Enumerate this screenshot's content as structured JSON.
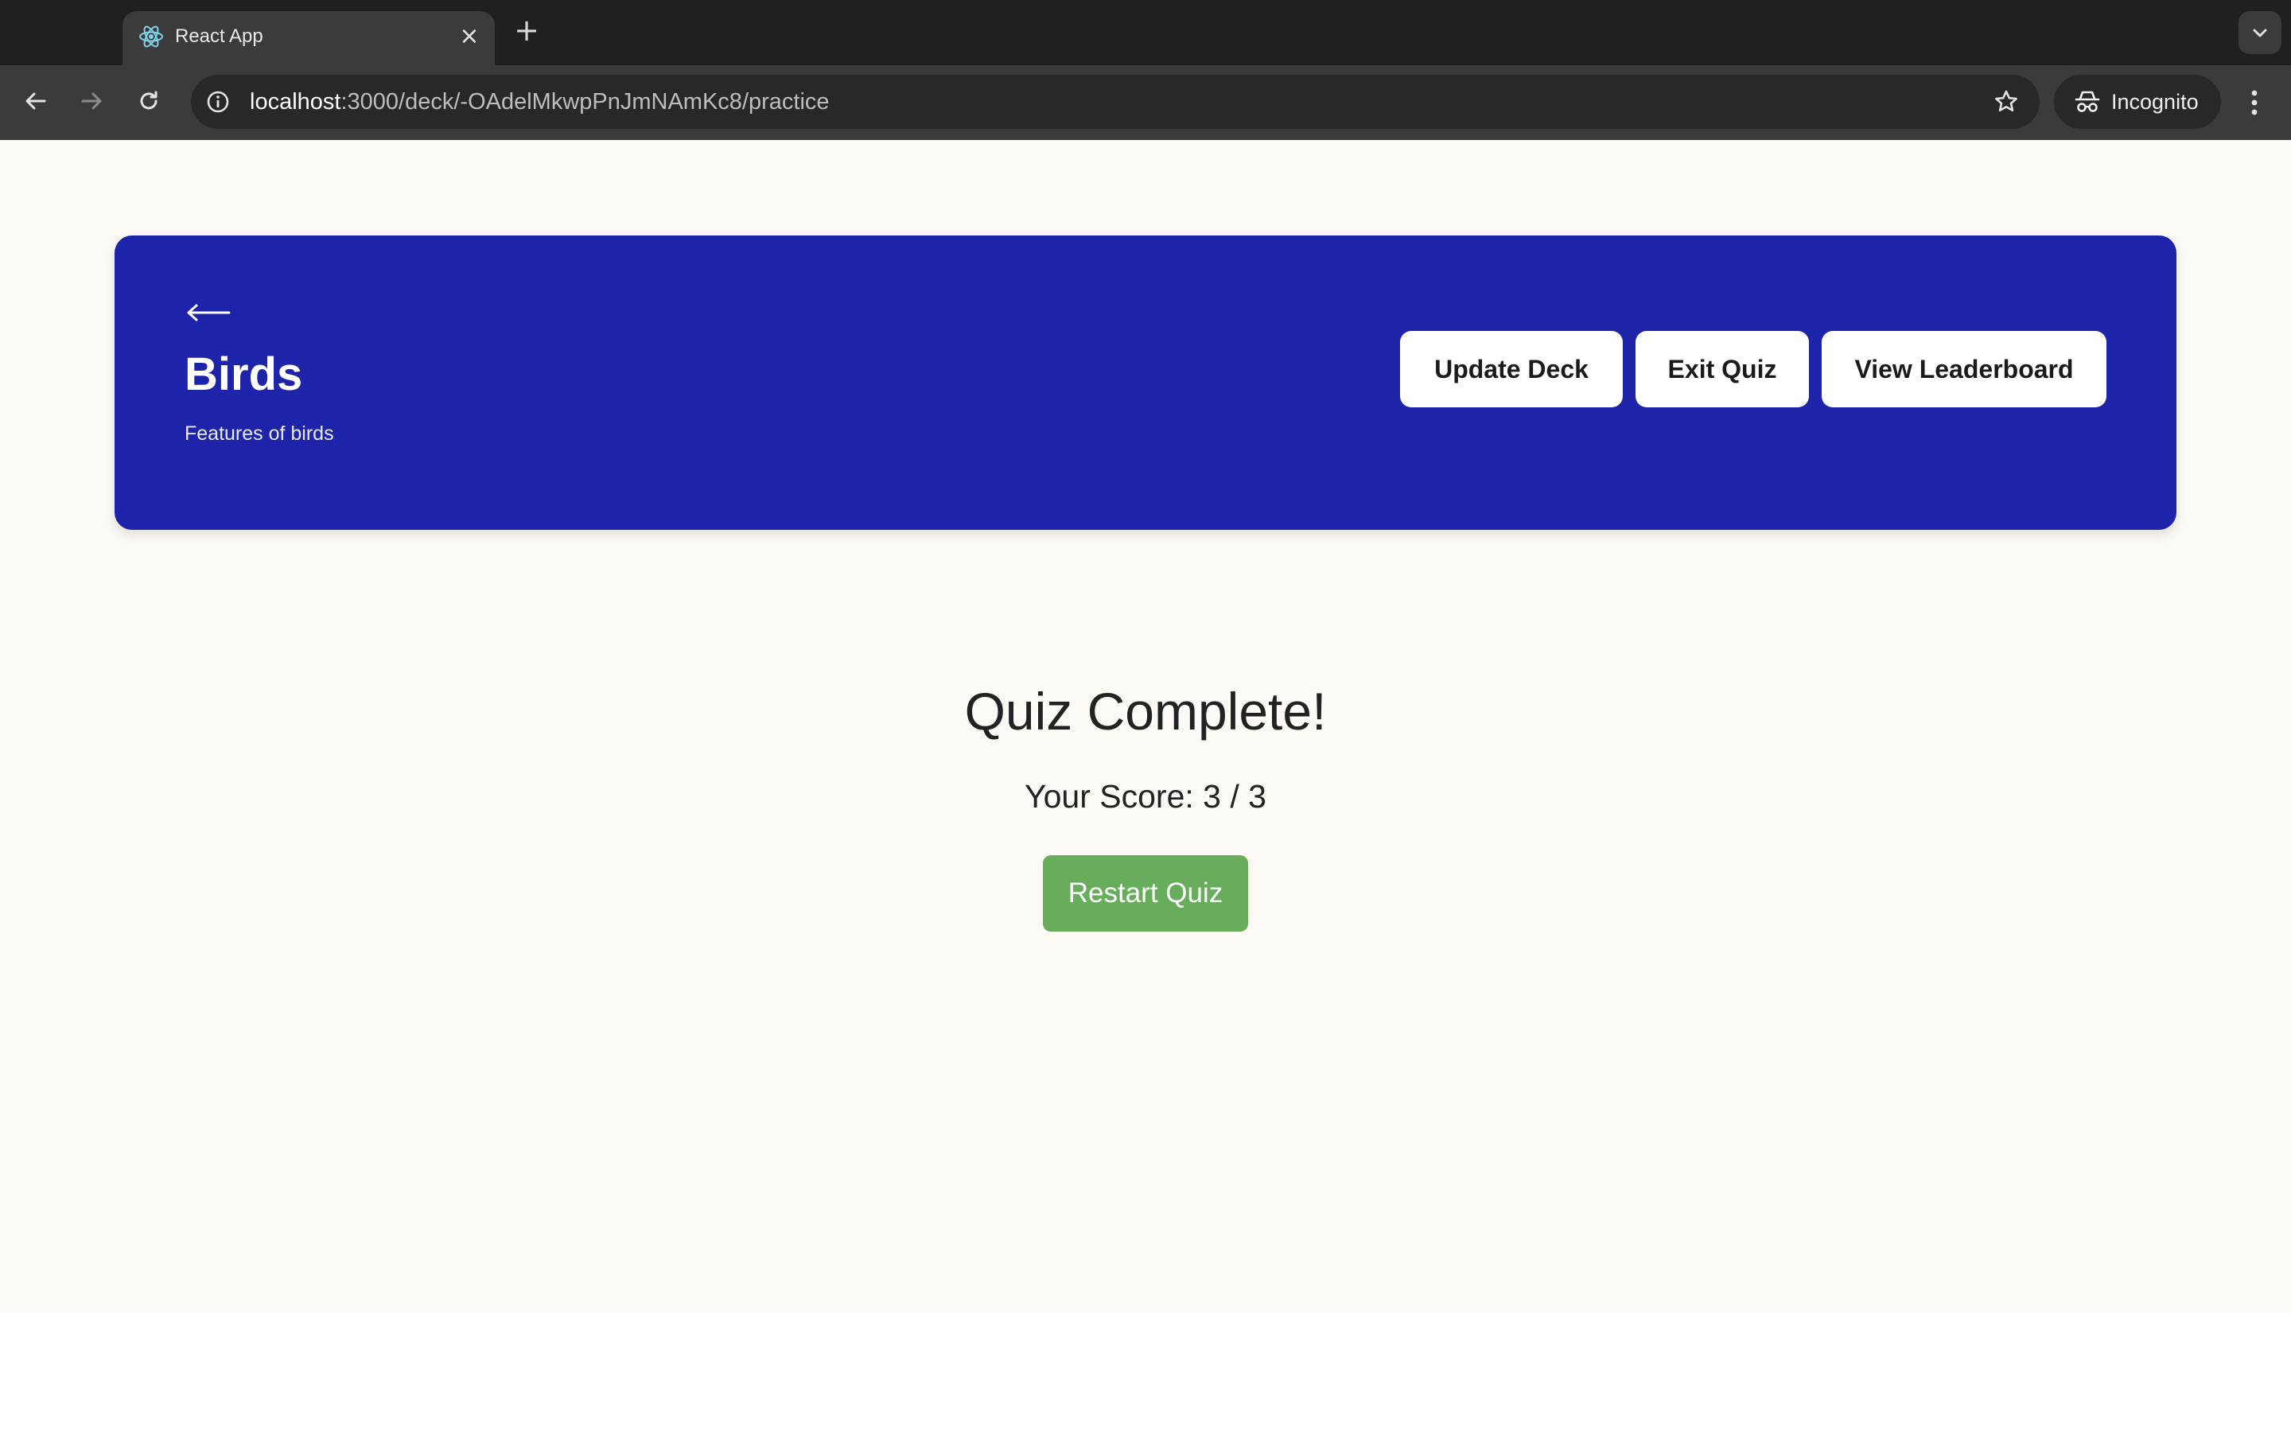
{
  "browser": {
    "tab": {
      "title": "React App",
      "favicon": "react-logo-icon",
      "close_glyph": "×"
    },
    "new_tab_glyph": "+",
    "address": {
      "host": "localhost",
      "path": ":3000/deck/-OAdelMkwpPnJmNAmKc8/practice"
    },
    "profile_label": "Incognito",
    "icons": {
      "back": "back-arrow-icon",
      "forward": "forward-arrow-icon",
      "reload": "reload-icon",
      "site_info": "info-icon",
      "bookmark": "star-icon",
      "incognito": "incognito-icon",
      "menu": "kebab-menu-icon",
      "tab_search": "chevron-down-icon"
    }
  },
  "deck": {
    "title": "Birds",
    "description": "Features of birds",
    "buttons": {
      "update": "Update Deck",
      "exit": "Exit Quiz",
      "leaderboard": "View Leaderboard"
    }
  },
  "result": {
    "title": "Quiz Complete!",
    "score_text": "Your Score: 3 / 3",
    "score": 3,
    "total": 3,
    "restart_label": "Restart Quiz"
  },
  "colors": {
    "header_bg": "#1e24aa",
    "page_bg": "#fdfaf5",
    "restart_bg": "#67ad5b"
  }
}
